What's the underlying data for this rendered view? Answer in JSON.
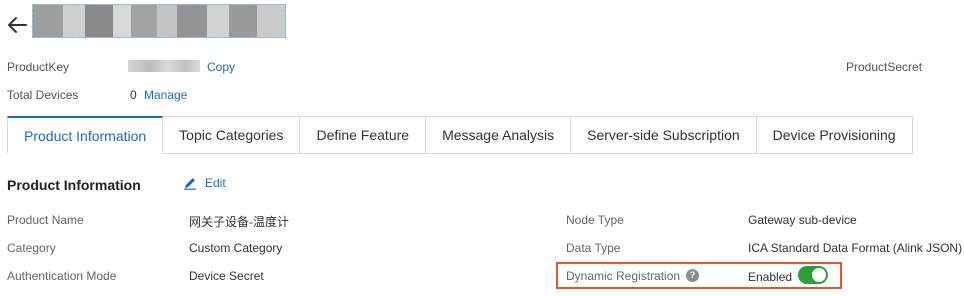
{
  "header": {
    "title_redacted": ""
  },
  "meta": {
    "product_key_label": "ProductKey",
    "copy_link": "Copy",
    "product_secret_label": "ProductSecret",
    "total_devices_label": "Total Devices",
    "total_devices_value": "0",
    "manage_link": "Manage"
  },
  "tabs": [
    {
      "label": "Product Information",
      "active": true
    },
    {
      "label": "Topic Categories",
      "active": false
    },
    {
      "label": "Define Feature",
      "active": false
    },
    {
      "label": "Message Analysis",
      "active": false
    },
    {
      "label": "Server-side Subscription",
      "active": false
    },
    {
      "label": "Device Provisioning",
      "active": false
    }
  ],
  "section": {
    "title": "Product Information",
    "edit_label": "Edit"
  },
  "fields": {
    "product_name_label": "Product Name",
    "product_name_value": "网关子设备-温度计",
    "category_label": "Category",
    "category_value": "Custom Category",
    "auth_mode_label": "Authentication Mode",
    "auth_mode_value": "Device Secret",
    "node_type_label": "Node Type",
    "node_type_value": "Gateway sub-device",
    "data_type_label": "Data Type",
    "data_type_value": "ICA Standard Data Format (Alink JSON)",
    "dynamic_reg_label": "Dynamic Registration",
    "dynamic_reg_value": "Enabled",
    "dynamic_reg_enabled": true
  },
  "colors": {
    "accent": "#1f6bc4",
    "toggle_on": "#2e9e3c",
    "highlight_border": "#e8542c"
  },
  "icons": {
    "back": "arrow-left-icon",
    "edit": "pencil-icon",
    "help": "question-circle-icon"
  }
}
